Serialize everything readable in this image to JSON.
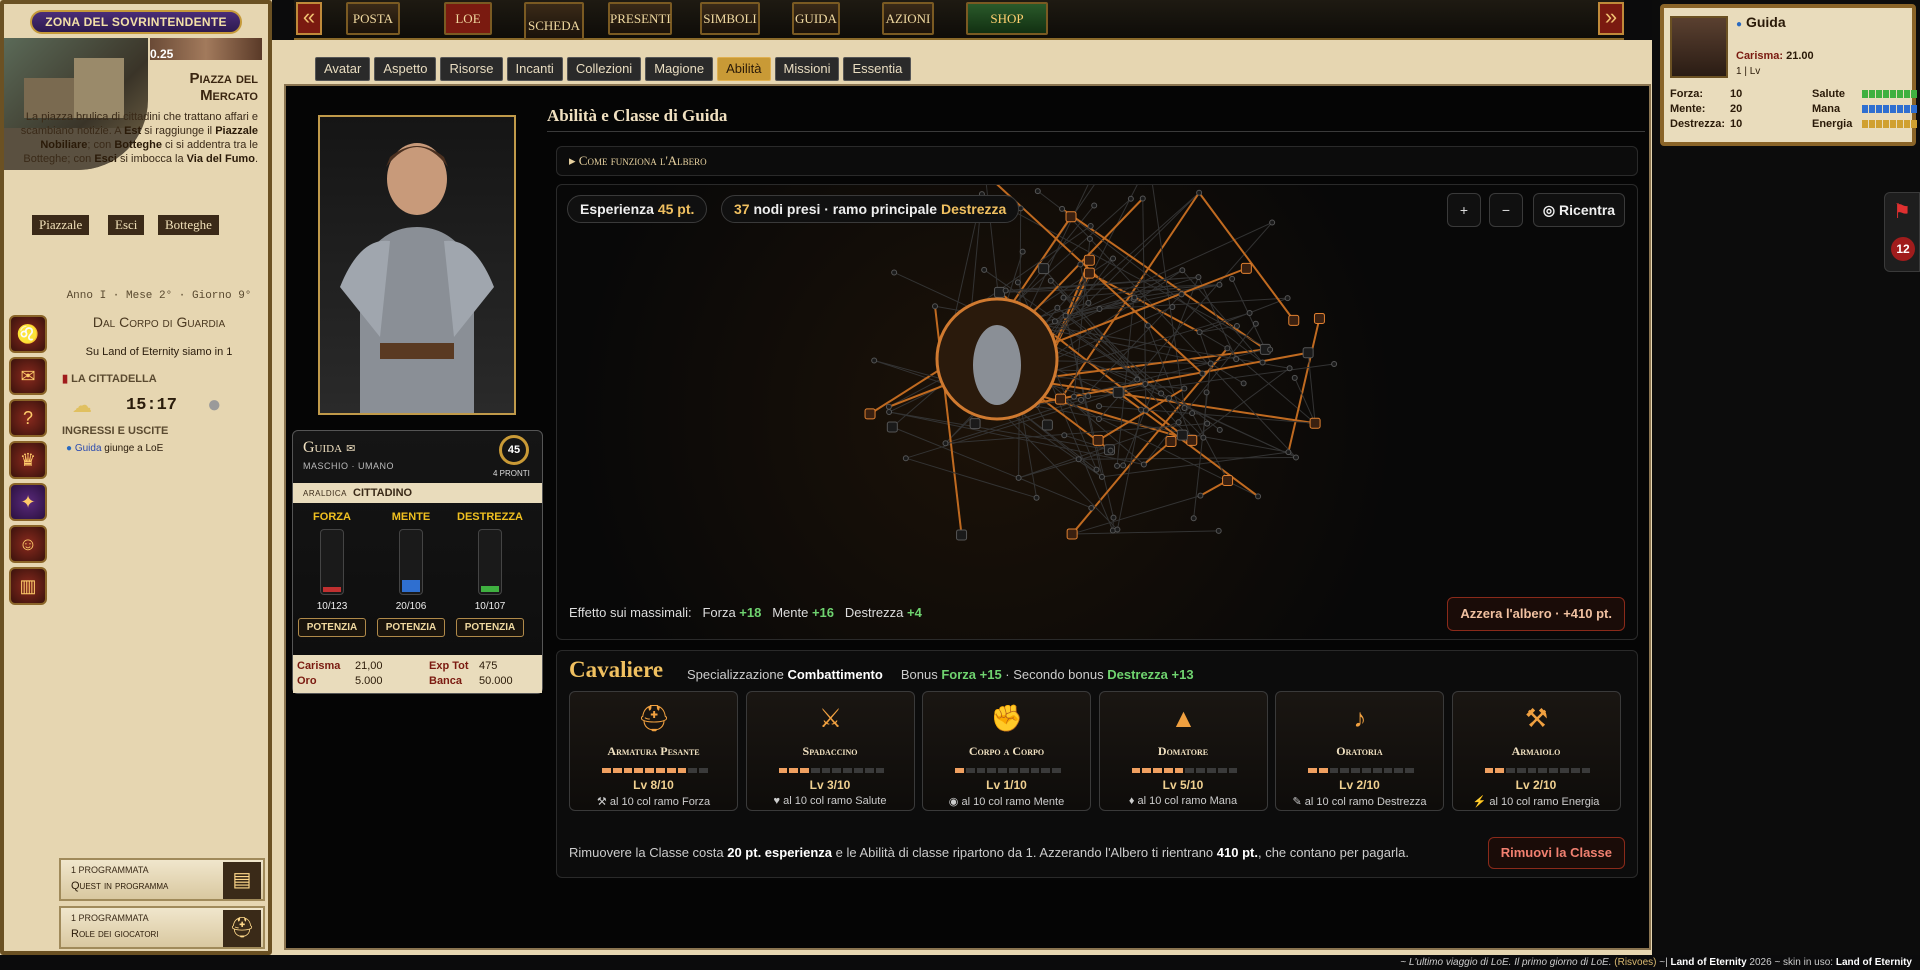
{
  "left": {
    "zona": "ZONA DEL SOVRINTENDENTE",
    "level_tag": "0.25",
    "place_title": "Piazza del Mercato",
    "place_desc_1": "La piazza brulica di cittadini che trattano affari e scambiano notizie. A ",
    "est": "Est",
    "place_desc_2": " si raggiunge il ",
    "piazzale": "Piazzale Nobiliare",
    "place_desc_3": "; con ",
    "botteghe": "Botteghe",
    "place_desc_4": " ci si addentra tra le Botteghe; con ",
    "esci": "Esci",
    "place_desc_5": " si imbocca la ",
    "via": "Via del Fumo",
    "place_desc_6": ".",
    "buttons": [
      "Piazzale",
      "Esci",
      "Botteghe"
    ],
    "date": "Anno I · Mese 2° · Giorno 9°",
    "corpo": "Dal Corpo di Guardia",
    "land_text": "Su Land of Eternity siamo in 1",
    "city": "LA CITTADELLA",
    "time": "15:17",
    "io_title": "INGRESSI E USCITE",
    "io_user": "Guida",
    "io_action": " giunge a LoE",
    "progs": [
      {
        "count": "1 PROGRAMMATA",
        "label": "Quest in programma",
        "icon": "book-icon"
      },
      {
        "count": "1 PROGRAMMATA",
        "label": "Role dei giocatori",
        "icon": "helmet-icon"
      }
    ]
  },
  "nav": {
    "items": [
      "POSTA",
      "LOE",
      "SCHEDA",
      "PRESENTI",
      "SIMBOLI",
      "GUIDA",
      "AZIONI",
      "SHOP"
    ],
    "prev": "«",
    "next": "»"
  },
  "tabs": [
    "Avatar",
    "Aspetto",
    "Risorse",
    "Incanti",
    "Collezioni",
    "Magione",
    "Abilità",
    "Missioni",
    "Essentia"
  ],
  "active_tab": "Abilità",
  "char": {
    "name": "Guida",
    "sub": "MASCHIO · UMANO",
    "level": "45",
    "pronti": "4 PRONTI",
    "aral_k": "ARALDICA",
    "aral_v": "CITTADINO",
    "stats": [
      {
        "label": "FORZA",
        "value": "10/123",
        "fill": 0.08,
        "color": "#c03030",
        "btn": "POTENZIA"
      },
      {
        "label": "MENTE",
        "value": "20/106",
        "fill": 0.19,
        "color": "#2f6fd0",
        "btn": "POTENZIA"
      },
      {
        "label": "DESTREZZA",
        "value": "10/107",
        "fill": 0.09,
        "color": "#3fb040",
        "btn": "POTENZIA"
      }
    ],
    "econ": {
      "carisma_k": "Carisma",
      "carisma_v": "21,00",
      "exp_k": "Exp Tot",
      "exp_v": "475",
      "oro_k": "Oro",
      "oro_v": "5.000",
      "banca_k": "Banca",
      "banca_v": "50.000"
    }
  },
  "abilita": {
    "title": "Abilità e Classe di Guida",
    "howto": "▸ Come funziona l'Albero",
    "exp_label": "Esperienza",
    "exp_value": "45 pt.",
    "nodes_count": "37",
    "nodes_text": " nodi presi · ramo principale ",
    "nodes_branch": "Destrezza",
    "zoom_in": "+",
    "zoom_out": "−",
    "ricentra": "Ricentra",
    "effetto_label": "Effetto sui massimali:",
    "eff": [
      {
        "k": "Forza",
        "v": "+18"
      },
      {
        "k": "Mente",
        "v": "+16"
      },
      {
        "k": "Destrezza",
        "v": "+4"
      }
    ],
    "azzera": "Azzera l'albero · +410 pt."
  },
  "classe": {
    "title": "Cavaliere",
    "spec_k": "Specializzazione ",
    "spec_v": "Combattimento",
    "bonus_k": "Bonus ",
    "bonus_v": "Forza +15",
    "bonus2_k": " · Secondo bonus ",
    "bonus2_v": "Destrezza +13",
    "skills": [
      {
        "name": "Armatura Pesante",
        "lv": "Lv 8/10",
        "level": 8,
        "sub": "al 10 col ramo Forza",
        "icon": "helmet-icon",
        "glyph": "⛑",
        "subicon": "axe-icon",
        "subglyph": "⚒"
      },
      {
        "name": "Spadaccino",
        "lv": "Lv 3/10",
        "level": 3,
        "sub": "al 10 col ramo Salute",
        "icon": "crossed-swords-icon",
        "glyph": "⚔",
        "subicon": "heart-icon",
        "subglyph": "♥"
      },
      {
        "name": "Corpo a Corpo",
        "lv": "Lv 1/10",
        "level": 1,
        "sub": "al 10 col ramo Mente",
        "icon": "fist-icon",
        "glyph": "✊",
        "subicon": "eye-icon",
        "subglyph": "◉"
      },
      {
        "name": "Domatore",
        "lv": "Lv 5/10",
        "level": 5,
        "sub": "al 10 col ramo Mana",
        "icon": "wolf-icon",
        "glyph": "▲",
        "subicon": "drop-icon",
        "subglyph": "♦"
      },
      {
        "name": "Oratoria",
        "lv": "Lv 2/10",
        "level": 2,
        "sub": "al 10 col ramo Destrezza",
        "icon": "horn-icon",
        "glyph": "♪",
        "subicon": "feather-icon",
        "subglyph": "✎"
      },
      {
        "name": "Armaiolo",
        "lv": "Lv 2/10",
        "level": 2,
        "sub": "al 10 col ramo Energia",
        "icon": "anvil-icon",
        "glyph": "⚒",
        "subicon": "bolt-icon",
        "subglyph": "⚡"
      }
    ],
    "rm_1": "Rimuovere la Classe costa ",
    "rm_2": "20 pt. esperienza",
    "rm_3": " e le Abilità di classe ripartono da 1. Azzerando l'Albero ti rientrano ",
    "rm_4": "410 pt.",
    "rm_5": ", che contano per pagarla.",
    "rimuovi": "Rimuovi la Classe"
  },
  "rcard": {
    "name": "Guida",
    "car_k": "Carisma:",
    "car_v": "21.00",
    "lvl": "1 | Lv",
    "stats": [
      {
        "k": "Forza:",
        "v": "10"
      },
      {
        "k": "Mente:",
        "v": "20"
      },
      {
        "k": "Destrezza:",
        "v": "10"
      }
    ],
    "bars": [
      {
        "k": "Salute",
        "c": "#3fb040"
      },
      {
        "k": "Mana",
        "c": "#2f6fd0"
      },
      {
        "k": "Energia",
        "c": "#d0a030"
      }
    ]
  },
  "flag_count": "12",
  "footer": {
    "q": "~ L'ultimo viaggio di LoE. Il primo giorno di LoE.",
    "r": "(Risvoes)",
    "s": " ~| ",
    "land": "Land of Eternity",
    "yr": " 2026 ~ skin in uso: ",
    "skin": "Land of Eternity"
  }
}
